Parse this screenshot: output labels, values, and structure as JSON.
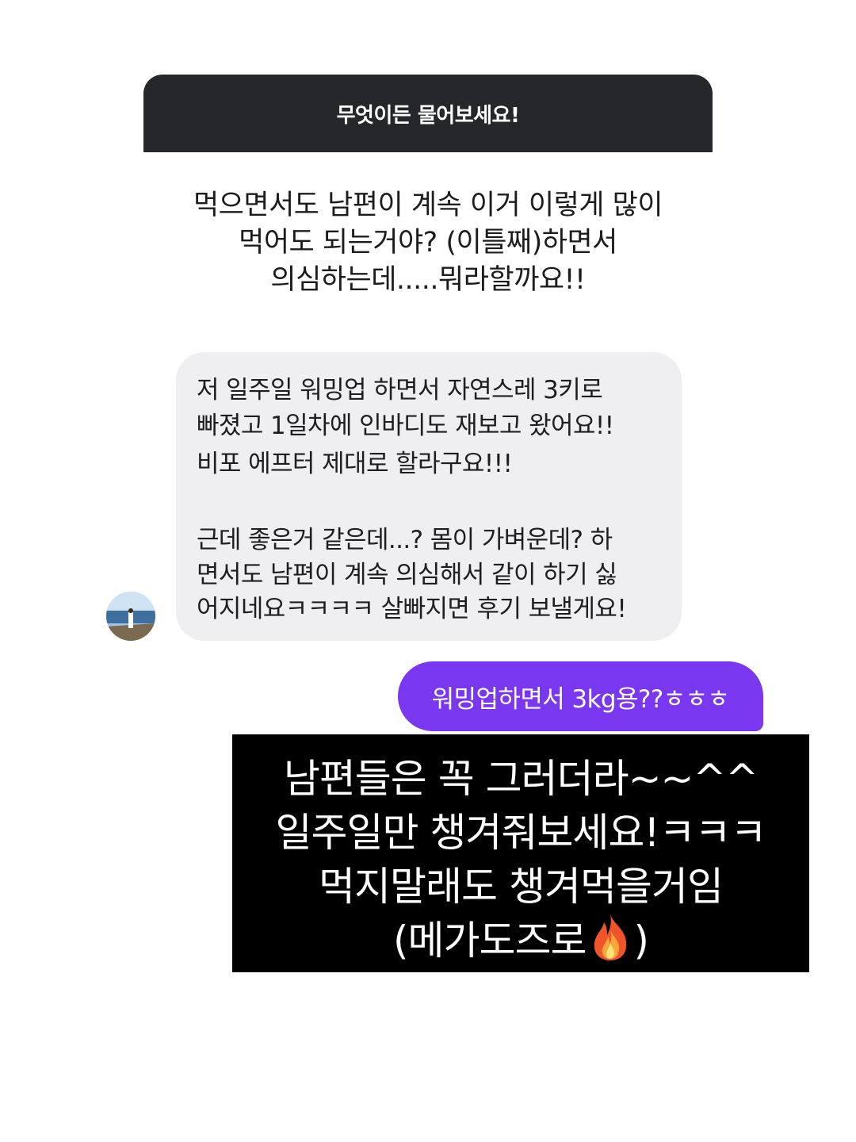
{
  "question": {
    "header": "무엇이든 물어보세요!",
    "lines": [
      "먹으면서도 남편이 계속 이거 이렇게 많이",
      "먹어도 되는거야? (이틀째)하면서",
      "의심하는데.....뭐라할까요!!"
    ]
  },
  "incoming": {
    "lines": [
      "저 일주일 워밍업 하면서 자연스레 3키로",
      "빠졌고 1일차에 인바디도 재보고 왔어요!!",
      "비포 에프터 제대로 할라구요!!!",
      "근데 좋은거 같은데...? 몸이 가벼운데? 하",
      "면서도 남편이 계속 의심해서 같이 하기 싫",
      "어지네요ㅋㅋㅋㅋ 살빠지면 후기 보낼게요!"
    ]
  },
  "outgoing": {
    "text": "워밍업하면서 3kg용??ㅎㅎㅎ"
  },
  "reply": {
    "line1": "남편들은 꼭 그러더라~~^^",
    "line2": "일주일만 챙겨줘보세요!ㅋㅋㅋ",
    "line3": "먹지말래도 챙겨먹을거임",
    "line4_start": "(메가도즈로",
    "line4_end": ")"
  },
  "colors": {
    "header_bg": "#26272b",
    "incoming_bg": "#efeff2",
    "outgoing_bg": "#7a37f0",
    "reply_bg": "#000000"
  },
  "icons": {
    "avatar": "profile-photo-avatar",
    "flame": "fire-emoji-icon"
  }
}
